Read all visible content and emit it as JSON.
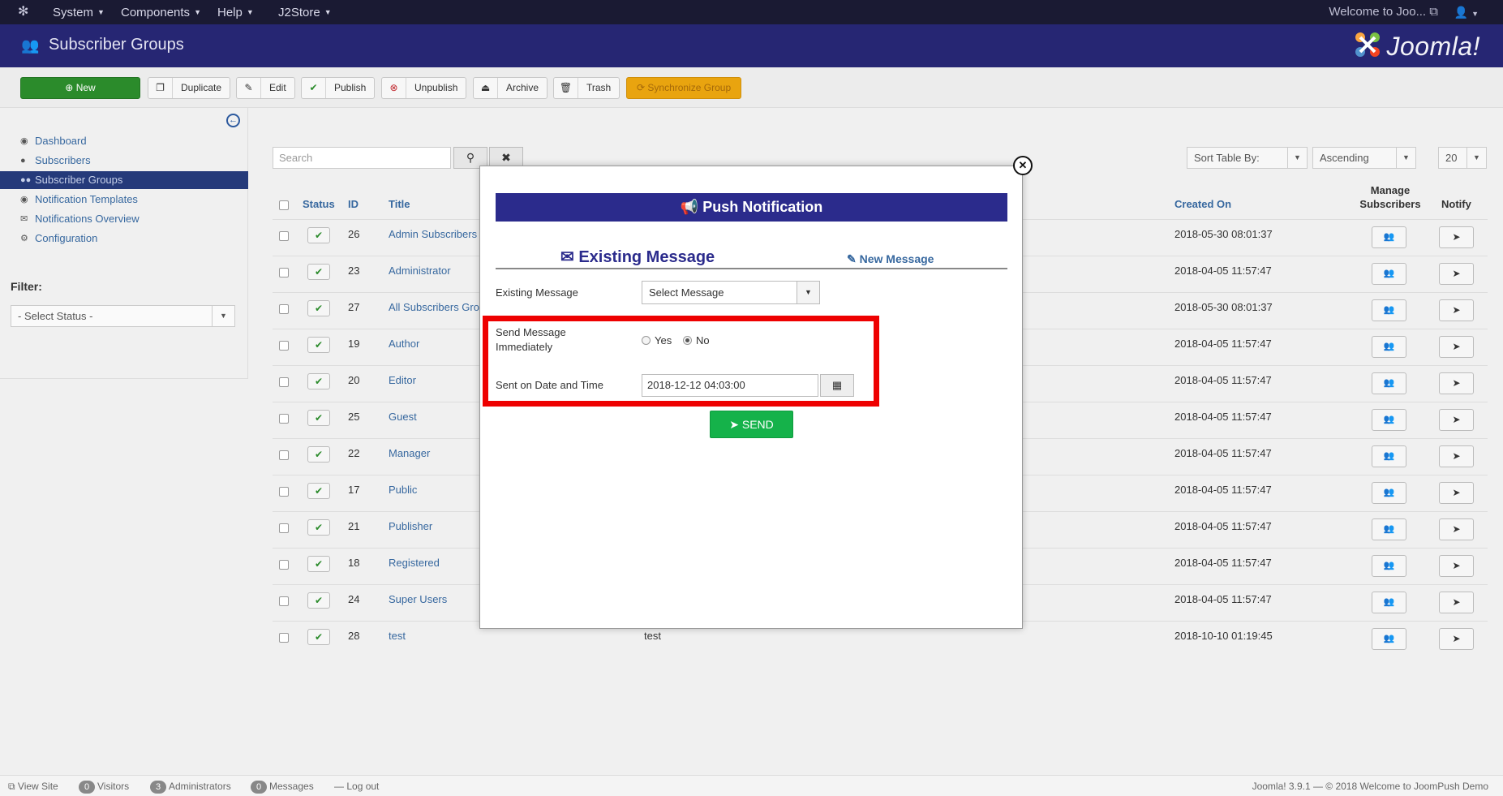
{
  "topnav": {
    "menus": [
      "System",
      "Components",
      "Help",
      "J2Store"
    ],
    "welcome": "Welcome to Joo...",
    "user_icon": "user-icon"
  },
  "header": {
    "title": "Subscriber Groups",
    "brand": "Joomla!"
  },
  "toolbar": {
    "new": "New",
    "duplicate": "Duplicate",
    "edit": "Edit",
    "publish": "Publish",
    "unpublish": "Unpublish",
    "archive": "Archive",
    "trash": "Trash",
    "sync": "Synchronize Group"
  },
  "sidebar": {
    "items": [
      "Dashboard",
      "Subscribers",
      "Subscriber Groups",
      "Notification Templates",
      "Notifications Overview",
      "Configuration"
    ],
    "active_index": 2,
    "filter_label": "Filter:",
    "status_select": "- Select Status -"
  },
  "list": {
    "search_placeholder": "Search",
    "sort_by": "Sort Table By:",
    "order": "Ascending",
    "limit": "20",
    "headers": {
      "status": "Status",
      "id": "ID",
      "title": "Title",
      "created": "Created On",
      "manage": "Manage Subscribers",
      "notify": "Notify"
    },
    "rows": [
      {
        "id": "26",
        "title": "Admin Subscribers",
        "desc": "",
        "date": "2018-05-30 08:01:37"
      },
      {
        "id": "23",
        "title": "Administrator",
        "desc": "",
        "date": "2018-04-05 11:57:47"
      },
      {
        "id": "27",
        "title": "All Subscribers Gro",
        "desc": "",
        "date": "2018-05-30 08:01:37"
      },
      {
        "id": "19",
        "title": "Author",
        "desc": "",
        "date": "2018-04-05 11:57:47"
      },
      {
        "id": "20",
        "title": "Editor",
        "desc": "",
        "date": "2018-04-05 11:57:47"
      },
      {
        "id": "25",
        "title": "Guest",
        "desc": "",
        "date": "2018-04-05 11:57:47"
      },
      {
        "id": "22",
        "title": "Manager",
        "desc": "",
        "date": "2018-04-05 11:57:47"
      },
      {
        "id": "17",
        "title": "Public",
        "desc": "",
        "date": "2018-04-05 11:57:47"
      },
      {
        "id": "21",
        "title": "Publisher",
        "desc": "",
        "date": "2018-04-05 11:57:47"
      },
      {
        "id": "18",
        "title": "Registered",
        "desc": "",
        "date": "2018-04-05 11:57:47"
      },
      {
        "id": "24",
        "title": "Super Users",
        "desc": "",
        "date": "2018-04-05 11:57:47"
      },
      {
        "id": "28",
        "title": "test",
        "desc": "test",
        "date": "2018-10-10 01:19:45"
      }
    ]
  },
  "modal": {
    "title": "Push Notification",
    "tab_existing": "Existing Message",
    "tab_new": "New Message",
    "existing_label": "Existing Message",
    "existing_select": "Select Message",
    "send_now_label": "Send Message Immediately",
    "yes": "Yes",
    "no": "No",
    "selected_option": "No",
    "date_label": "Sent on Date and Time",
    "date_value": "2018-12-12 04:03:00",
    "send": "SEND",
    "highlight_color": "#ee0000"
  },
  "statusbar": {
    "view_site": "View Site",
    "visitors_count": "0",
    "visitors": "Visitors",
    "admins_count": "3",
    "admins": "Administrators",
    "messages_count": "0",
    "messages": "Messages",
    "logout": "Log out",
    "right": "Joomla! 3.9.1  —  © 2018 Welcome to JoomPush Demo"
  },
  "colors": {
    "nav_bg": "#1a1a33",
    "header_bg": "#262673",
    "new_btn": "#2b8b2b",
    "sync_btn": "#e9a40f",
    "modal_bar": "#2b2b8c",
    "send_btn": "#15b24a",
    "link": "#37689f"
  }
}
